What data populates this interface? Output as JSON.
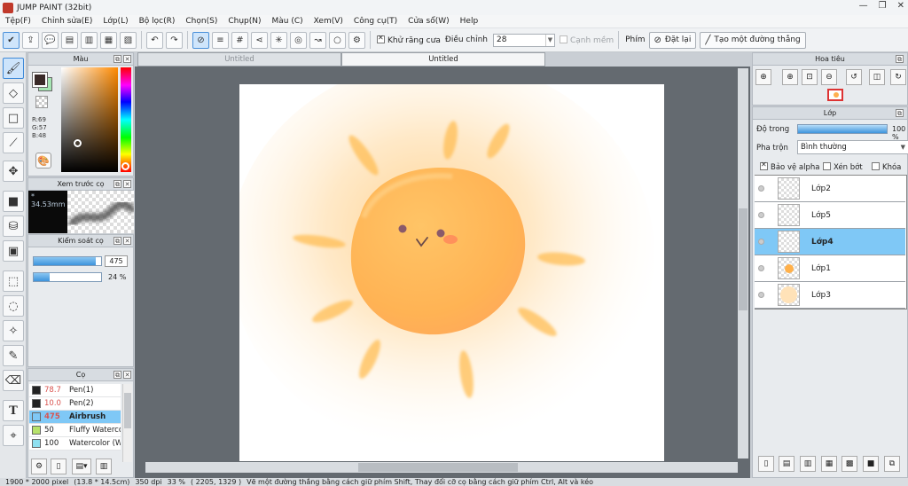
{
  "window": {
    "title": "JUMP PAINT (32bit)",
    "controls": [
      "—",
      "❐",
      "✕"
    ]
  },
  "menu": [
    "Tệp(F)",
    "Chỉnh sửa(E)",
    "Lớp(L)",
    "Bộ lọc(R)",
    "Chọn(S)",
    "Chụp(N)",
    "Màu (C)",
    "Xem(V)",
    "Công cụ(T)",
    "Cửa sổ(W)",
    "Help"
  ],
  "toolbar": {
    "antialias_label": "Khử răng cưa",
    "adjust_label": "Điều chỉnh",
    "adjust_value": "28",
    "edge_label": "Cạnh mềm",
    "key_label": "Phím",
    "reset_label": "Đặt lại",
    "straight_line_label": "Tạo một đường thẳng"
  },
  "color_panel": {
    "title": "Màu",
    "r": "R:69",
    "g": "G:57",
    "b": "B:48",
    "fg_color": "#3a2a28",
    "bg_color": "#a6e6b3"
  },
  "brush_preview": {
    "title": "Xem trước cọ",
    "size": "* 34.53mm"
  },
  "brush_control": {
    "title": "Kiểm soát cọ",
    "size_value": "475",
    "size_level": 0.92,
    "opacity_value": "24 %",
    "opacity_level": 0.24
  },
  "brush_list": {
    "title": "Cọ",
    "items": [
      {
        "size": "78.7",
        "name": "Pen(1)",
        "color": "#222222",
        "size_color": "#d9534f"
      },
      {
        "size": "10.0",
        "name": "Pen(2)",
        "color": "#222222",
        "size_color": "#d9534f"
      },
      {
        "size": "475",
        "name": "Airbrush",
        "color": "#7fc8f6",
        "size_color": "#d9534f"
      },
      {
        "size": "50",
        "name": "Fluffy Watercolor",
        "color": "#b6e26a",
        "size_color": "#222222"
      },
      {
        "size": "100",
        "name": "Watercolor (Wet)",
        "color": "#8fe0f0",
        "size_color": "#222222"
      }
    ]
  },
  "tabs": [
    "Untitled",
    "Untitled"
  ],
  "navigator": {
    "title": "Hoa tiêu"
  },
  "layers": {
    "title": "Lớp",
    "opacity_label": "Độ trong",
    "opacity_value": "100 %",
    "blend_label": "Pha trộn",
    "blend_value": "Bình thường",
    "protect_alpha_label": "Bảo vệ alpha",
    "clip_label": "Xén bớt",
    "lock_label": "Khóa",
    "items": [
      {
        "name": "Lớp2"
      },
      {
        "name": "Lớp5"
      },
      {
        "name": "Lớp4"
      },
      {
        "name": "Lớp1"
      },
      {
        "name": "Lớp3"
      }
    ]
  },
  "status": {
    "size": "1900 * 2000 pixel",
    "physical": "(13.8 * 14.5cm)",
    "dpi": "350 dpi",
    "zoom": "33 %",
    "coords": "( 2205, 1329 )",
    "hint": "Vẽ một đường thẳng bằng cách giữ phím Shift, Thay đổi cỡ cọ bằng cách giữ phím Ctrl, Alt và kéo"
  }
}
